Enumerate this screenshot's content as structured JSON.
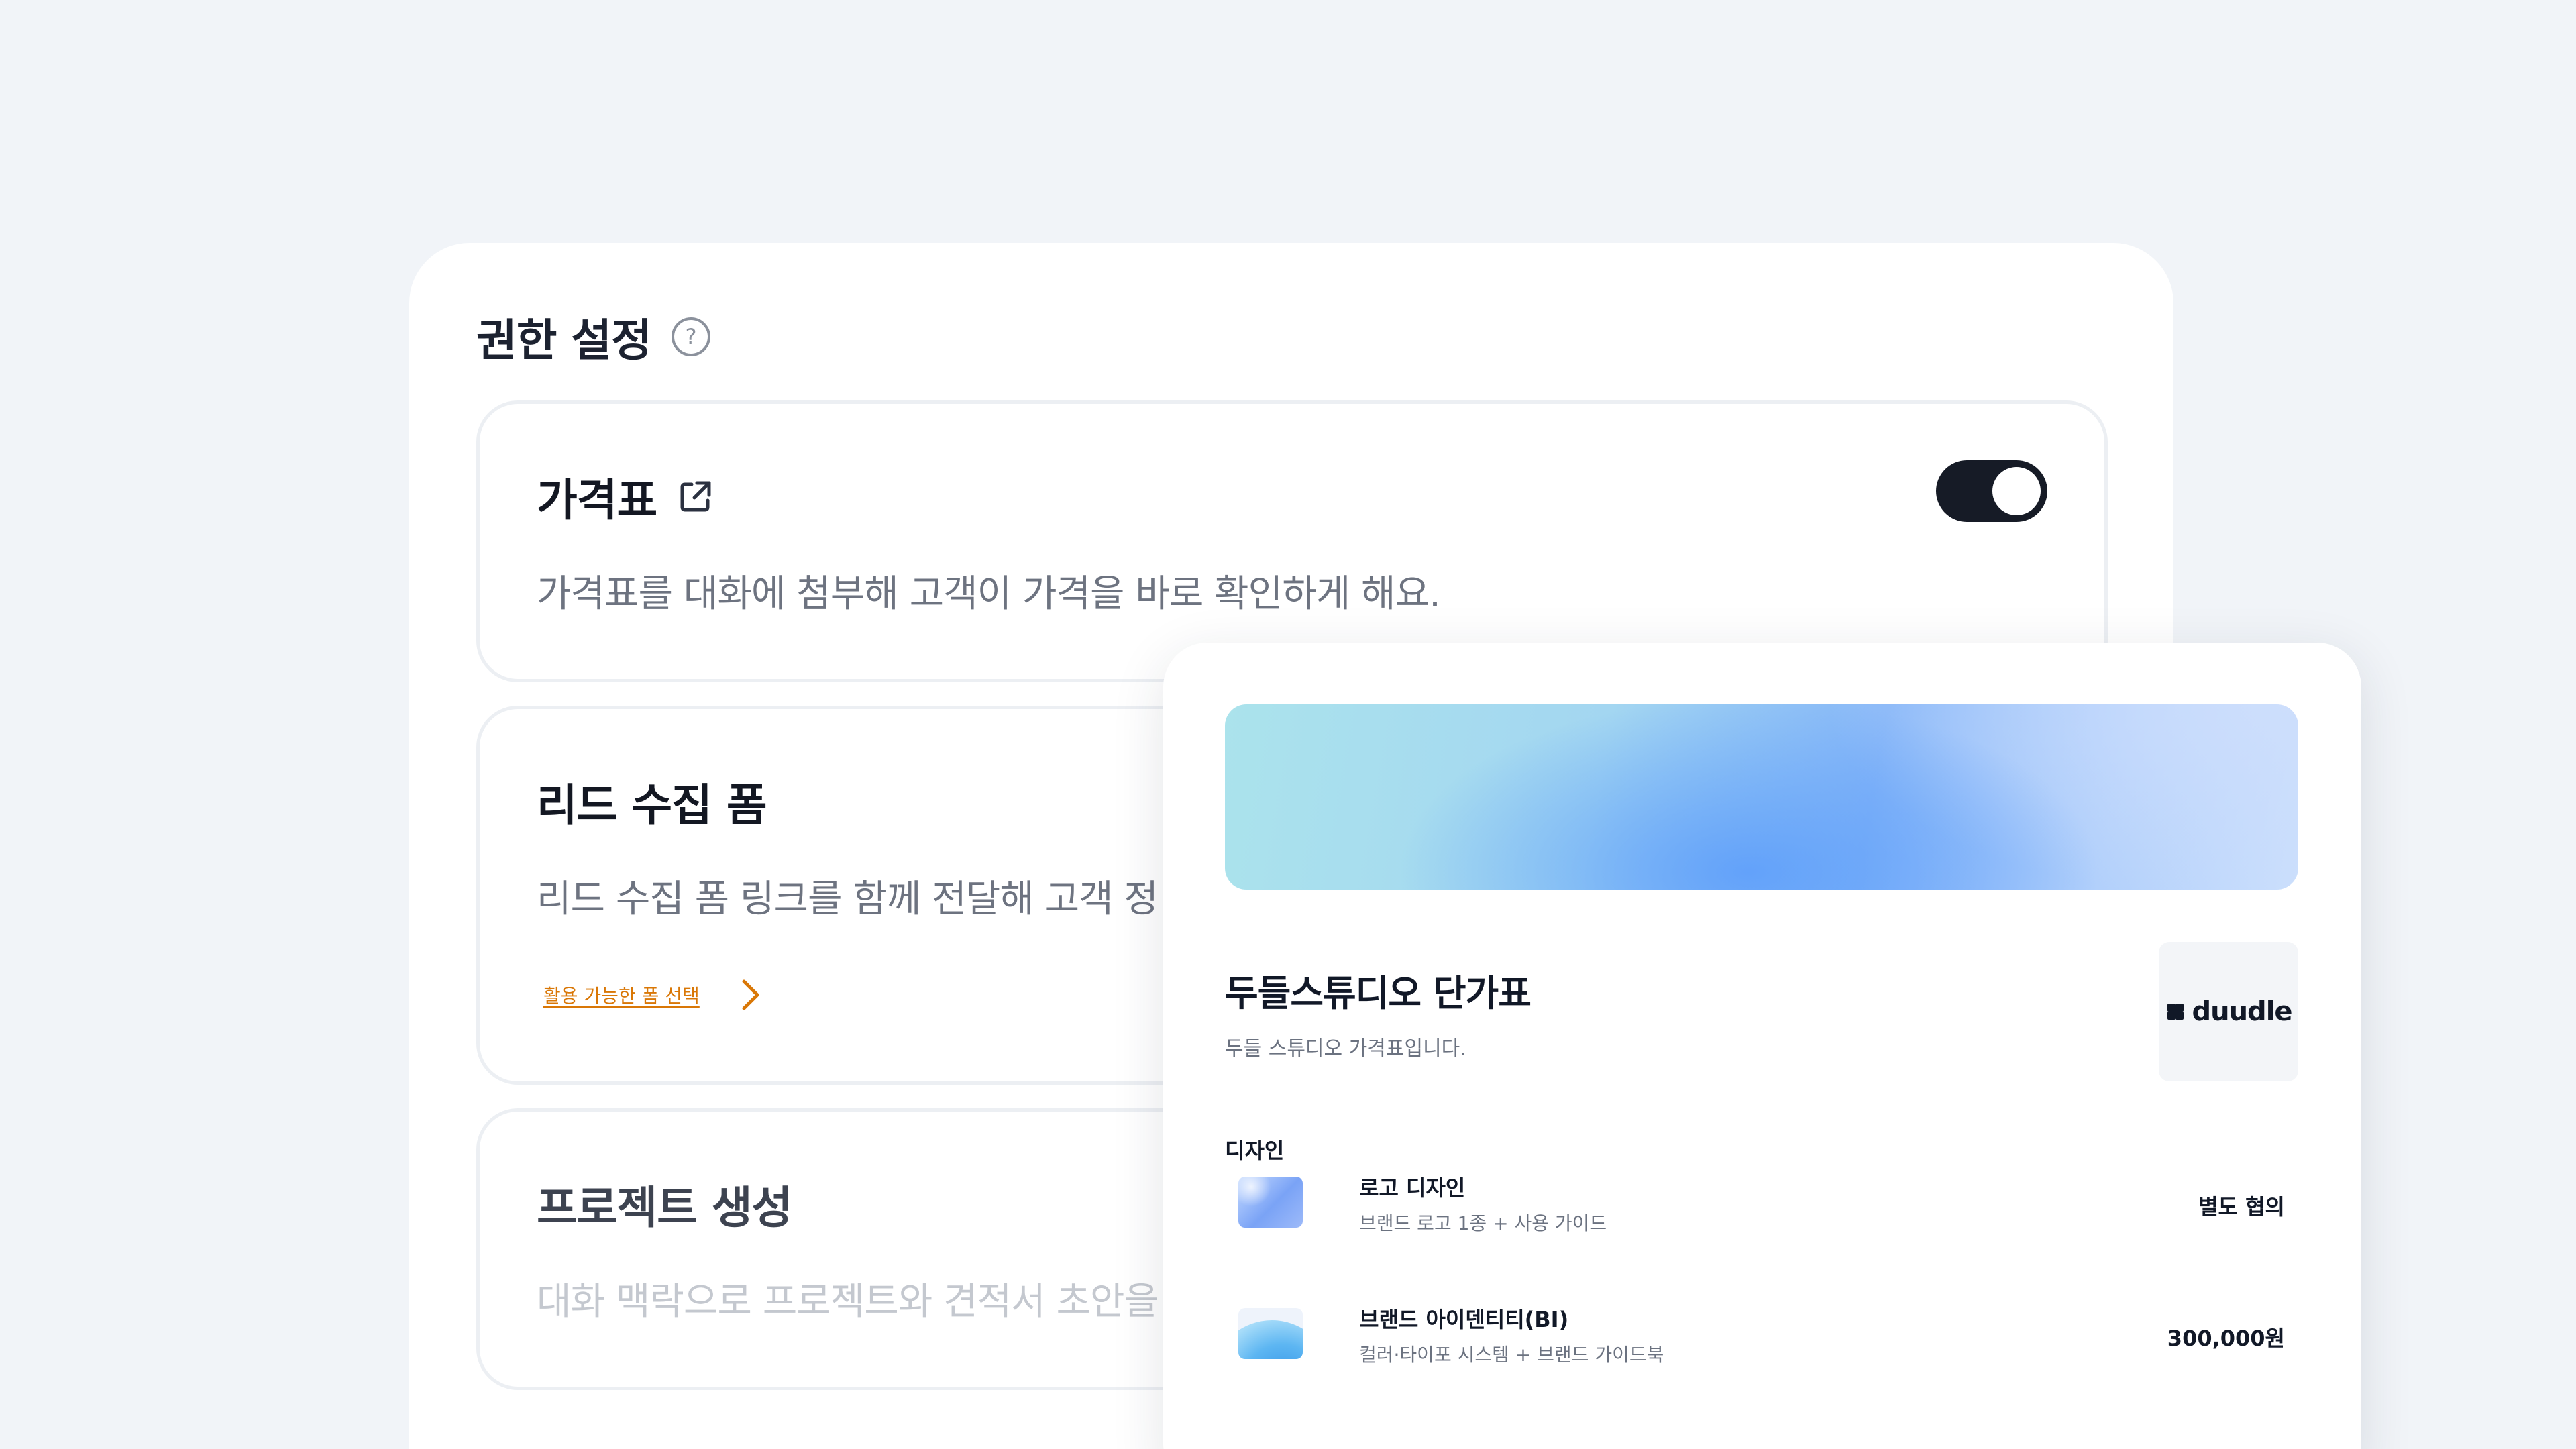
{
  "settings": {
    "title": "권한 설정",
    "cards": [
      {
        "title": "가격표",
        "description": "가격표를 대화에 첨부해 고객이 가격을 바로 확인하게 해요.",
        "toggle_on": true
      },
      {
        "title": "리드 수집 폼",
        "description": "리드 수집 폼 링크를 함께 전달해 고객 정",
        "link_label": "활용 가능한 폼 선택"
      },
      {
        "title": "프로젝트 생성",
        "description": "대화 맥락으로 프로젝트와 견적서 초안을"
      }
    ]
  },
  "pricing": {
    "title": "두들스튜디오 단가표",
    "subtitle": "두들 스튜디오 가격표입니다.",
    "brand_name": "duudle",
    "category": "디자인",
    "items": [
      {
        "name": "로고 디자인",
        "description": "브랜드 로고 1종 + 사용 가이드",
        "price": "별도 협의"
      },
      {
        "name": "브랜드 아이덴티티(BI)",
        "description": "컬러·타이포 시스템 + 브랜드 가이드북",
        "price": "300,000원"
      }
    ]
  },
  "colors": {
    "background": "#f1f4f8",
    "toggle_on": "#161b26",
    "link_accent": "#d97706"
  }
}
